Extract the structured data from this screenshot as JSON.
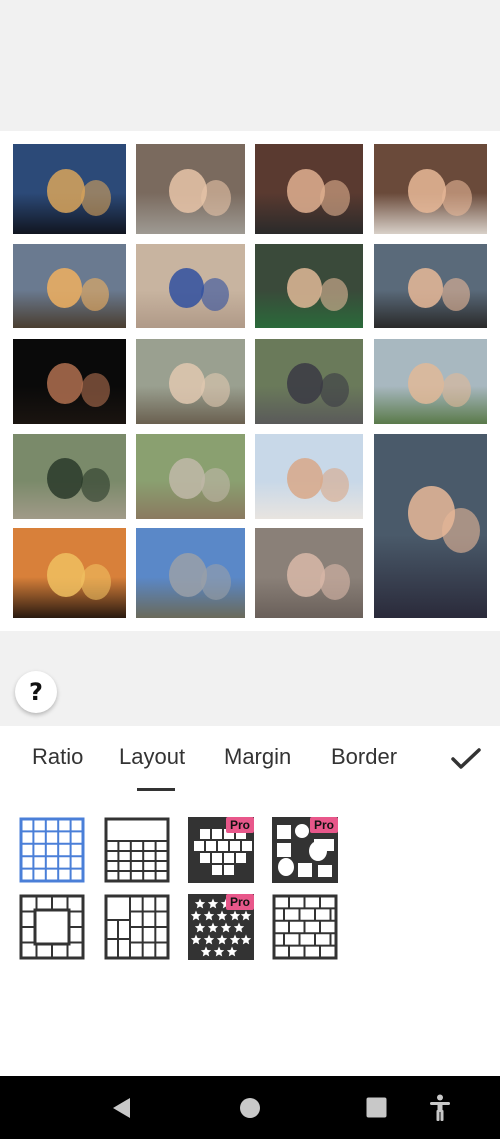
{
  "collage": {
    "photos": [
      {
        "name": "photo-dusk-sky",
        "sky": "#2c4a78",
        "ground": "#111520",
        "accent": "#d9a45a"
      },
      {
        "name": "photo-kids-sleeping",
        "sky": "#7a6a5e",
        "ground": "#9e9a93",
        "accent": "#e8c4a8"
      },
      {
        "name": "photo-family-selfie-1",
        "sky": "#5a3a30",
        "ground": "#2a2a2a",
        "accent": "#e0b090"
      },
      {
        "name": "photo-mother-son-kiss",
        "sky": "#6a4a3a",
        "ground": "#d8d0c8",
        "accent": "#e8b898"
      },
      {
        "name": "photo-sunset-desert",
        "sky": "#6a7a90",
        "ground": "#4a3e30",
        "accent": "#f0b060"
      },
      {
        "name": "photo-child-on-swing",
        "sky": "#c8b4a0",
        "ground": "#b09a88",
        "accent": "#3050a0"
      },
      {
        "name": "photo-mother-son-selfie",
        "sky": "#3a4a3a",
        "ground": "#2a6a3a",
        "accent": "#e0b898"
      },
      {
        "name": "photo-couple-selfie-1",
        "sky": "#5a6a7a",
        "ground": "#2a2a2a",
        "accent": "#e8b898"
      },
      {
        "name": "photo-night-selfie",
        "sky": "#0a0a0a",
        "ground": "#1a1410",
        "accent": "#b07050"
      },
      {
        "name": "photo-family-outdoors",
        "sky": "#9aa090",
        "ground": "#6a6050",
        "accent": "#e0c8b0"
      },
      {
        "name": "photo-pickup-truck",
        "sky": "#6a7a5a",
        "ground": "#5a5a5a",
        "accent": "#3a3a44"
      },
      {
        "name": "photo-couple-coast",
        "sky": "#a8b8c0",
        "ground": "#5a7a4a",
        "accent": "#e0b898"
      },
      {
        "name": "photo-trail-walk",
        "sky": "#7a8a6a",
        "ground": "#a09a88",
        "accent": "#2a3a2a"
      },
      {
        "name": "photo-creek-bridge",
        "sky": "#8aa070",
        "ground": "#8a7a60",
        "accent": "#c0b8a8"
      },
      {
        "name": "photo-family-selfie-2",
        "sky": "#c8d8e8",
        "ground": "#e8e4e0",
        "accent": "#d8a888"
      },
      {
        "name": "photo-family-large",
        "sky": "#4a5a6a",
        "ground": "#2a2a3a",
        "accent": "#e8b898"
      },
      {
        "name": "photo-orange-sunset",
        "sky": "#d8803a",
        "ground": "#2a1a10",
        "accent": "#f0c060"
      },
      {
        "name": "photo-city-skyline",
        "sky": "#5a88c8",
        "ground": "#6a6a5a",
        "accent": "#9aa0a8"
      },
      {
        "name": "photo-pitbull-dog",
        "sky": "#8a8078",
        "ground": "#6a605a",
        "accent": "#d8b8a8"
      }
    ]
  },
  "help": {
    "label": "?"
  },
  "tabs": [
    {
      "name": "tab-ratio",
      "label": "Ratio"
    },
    {
      "name": "tab-layout",
      "label": "Layout"
    },
    {
      "name": "tab-margin",
      "label": "Margin"
    },
    {
      "name": "tab-border",
      "label": "Border"
    }
  ],
  "active_tab": "Layout",
  "layouts": {
    "pro_label": "Pro",
    "items": [
      {
        "name": "layout-grid-4x5",
        "selected": true
      },
      {
        "name": "layout-grid-rows"
      },
      {
        "name": "layout-heart",
        "pro": true
      },
      {
        "name": "layout-circles",
        "pro": true
      },
      {
        "name": "layout-frame-center"
      },
      {
        "name": "layout-mixed-grid"
      },
      {
        "name": "layout-stars",
        "pro": true
      },
      {
        "name": "layout-brick"
      }
    ]
  },
  "colors": {
    "selected": "#4a7fd8",
    "icon": "#333333",
    "pro_badge": "#e8578a"
  }
}
